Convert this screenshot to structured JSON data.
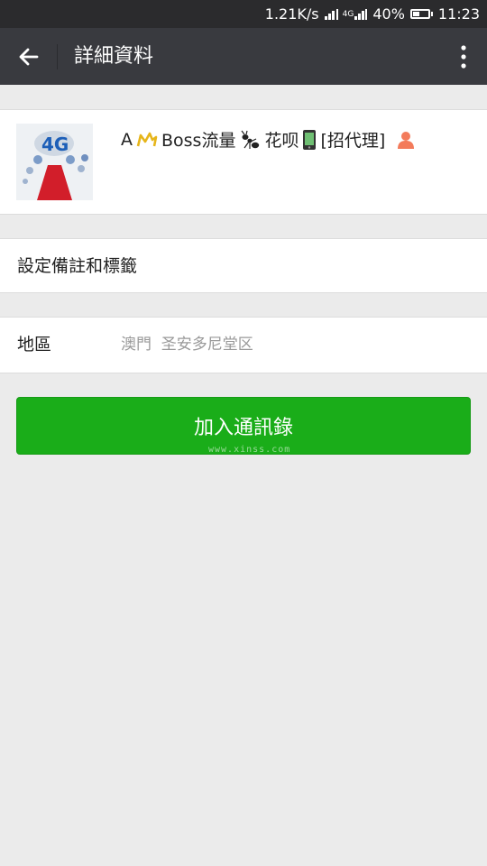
{
  "status": {
    "speed": "1.21K/s",
    "net_type": "4G",
    "battery": "40%",
    "time": "11:23"
  },
  "header": {
    "title": "詳細資料",
    "back_icon": "back-arrow-icon",
    "more_icon": "more-vertical-icon"
  },
  "profile": {
    "avatar_text": "4G",
    "name_parts": [
      "A",
      "Boss流量",
      "花呗",
      "[招代理]"
    ],
    "gender_icon": "person-icon",
    "gender_color": "#f37b5b"
  },
  "remark": {
    "label": "設定備註和標籤"
  },
  "region": {
    "label": "地區",
    "value": "澳門  圣安多尼堂区"
  },
  "actions": {
    "add_button": "加入通訊錄",
    "watermark": "www.xinss.com"
  },
  "colors": {
    "primary": "#1aad19",
    "title_bar": "#393a3f",
    "status_bar": "#2b2b2d",
    "background": "#ebebeb"
  }
}
